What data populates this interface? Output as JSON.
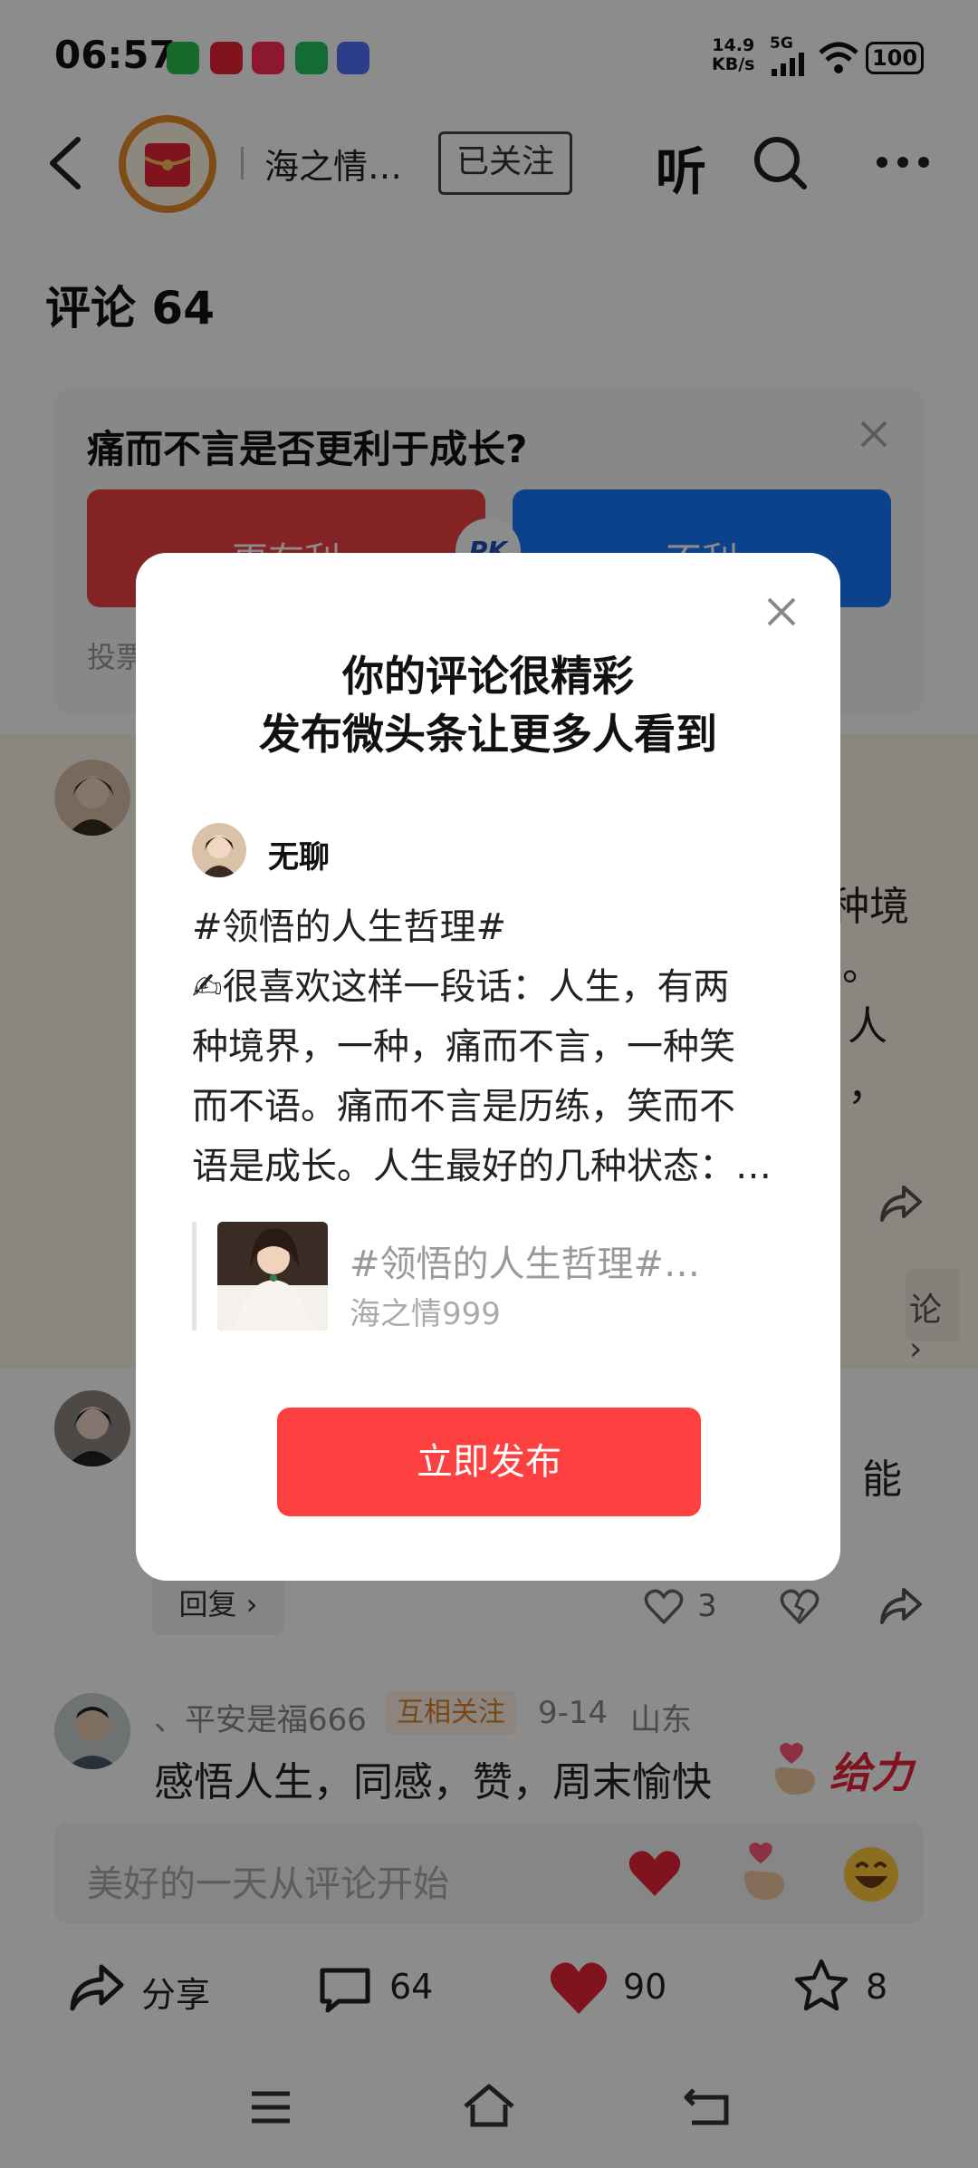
{
  "status_bar": {
    "time": "06:57",
    "speed_value": "14.9",
    "speed_unit": "KB/s",
    "network": "5G",
    "battery": "100"
  },
  "header": {
    "account_name": "海之情…",
    "follow_label": "已关注",
    "listen_label": "听"
  },
  "comments": {
    "title": "评论 64"
  },
  "poll": {
    "question": "痛而不言是否更利于成长?",
    "agree_label": "更有利",
    "disagree_label": "不利",
    "pk_label": "PK",
    "vote_label": "投票"
  },
  "comment1": {
    "text_line1": "种境",
    "text_line2": "。",
    "text_line3": "人",
    "text_line4": "，",
    "reply_suffix": "论 ›"
  },
  "comment2": {
    "text_fragment": "能",
    "reply_label": "回复 ›",
    "likes": "3"
  },
  "comment3": {
    "name": "、平安是福666",
    "badge": "互相关注",
    "date": "9-14",
    "location": "山东",
    "text": "感悟人生，同感，赞，周末愉快",
    "sticker_text": "给力"
  },
  "input": {
    "placeholder": "美好的一天从评论开始"
  },
  "bottom_bar": {
    "share_label": "分享",
    "comment_count": "64",
    "like_count": "90",
    "favorite_count": "8"
  },
  "modal": {
    "title_line1": "你的评论很精彩",
    "title_line2": "发布微头条让更多人看到",
    "username": "无聊",
    "post_lines": [
      "#领悟的人生哲理#",
      "✍很喜欢这样一段话：人生，有两",
      "种境界，一种，痛而不言，一种笑",
      "而不语。痛而不言是历练，笑而不",
      "语是成长。人生最好的几种状态：…"
    ],
    "quote_title": "#领悟的人生哲理#…",
    "quote_author": "海之情999",
    "publish_label": "立即发布"
  },
  "colors": {
    "accent_red": "#ff4040",
    "poll_blue": "#1677ff",
    "poll_red": "#f04040"
  }
}
